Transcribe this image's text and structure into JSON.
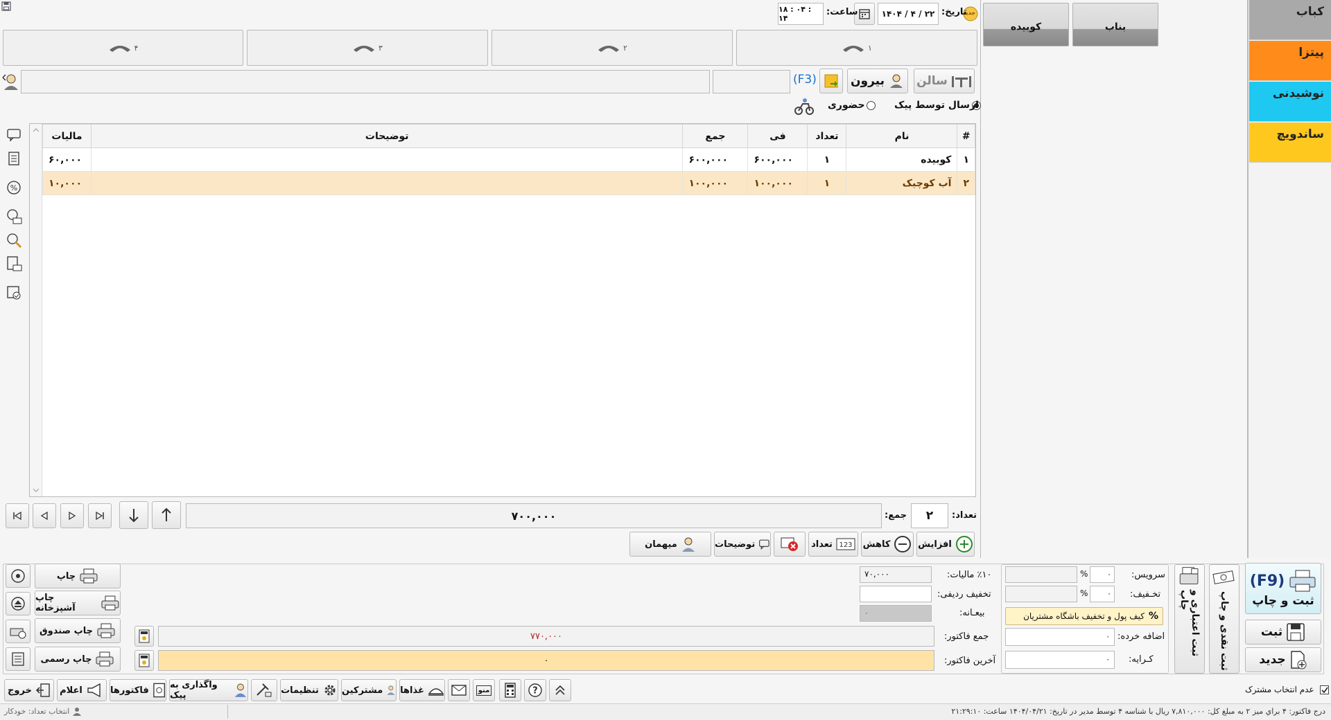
{
  "categories": [
    {
      "label": "کباب",
      "color": "#a9a9a9"
    },
    {
      "label": "پیتزا",
      "color": "#ff8c1a"
    },
    {
      "label": "نوشیدنی",
      "color": "#1ec8f0"
    },
    {
      "label": "ساندویچ",
      "color": "#ffc81e"
    }
  ],
  "products": [
    "بناب",
    "کوبیده"
  ],
  "header": {
    "new_badge": "جدید",
    "date_label": "تاریخ:",
    "date_value": "۱۴۰۴ / ۴ / ۲۲",
    "time_label": "ساعت:",
    "time_value": "۱۸ : ۰۴ : ۱۴"
  },
  "tables": [
    "۱",
    "۲",
    "۳",
    "۴"
  ],
  "order_mode": {
    "hall": "سالن",
    "out": "بیرون",
    "f3": "(F3)",
    "delivery": "ارسال توسط پیک",
    "dine_in": "حضوری"
  },
  "grid": {
    "headers": {
      "num": "#",
      "name": "نام",
      "qty": "تعداد",
      "price": "فی",
      "sum": "جمع",
      "desc": "توضیحات",
      "tax": "مالیات"
    },
    "rows": [
      {
        "num": "۱",
        "name": "کوبیده",
        "qty": "۱",
        "price": "۶۰۰,۰۰۰",
        "sum": "۶۰۰,۰۰۰",
        "desc": "",
        "tax": "۶۰,۰۰۰"
      },
      {
        "num": "۲",
        "name": "آب کوچیک",
        "qty": "۱",
        "price": "۱۰۰,۰۰۰",
        "sum": "۱۰۰,۰۰۰",
        "desc": "",
        "tax": "۱۰,۰۰۰"
      }
    ]
  },
  "totals": {
    "count_label": "تعداد:",
    "count_value": "۲",
    "sum_label": "جمع:",
    "sum_value": "۷۰۰,۰۰۰"
  },
  "row_actions": {
    "increase": "افزایش",
    "decrease": "کاهش",
    "qty": "تعداد",
    "desc": "توضیحات",
    "guest": "میهمان"
  },
  "summary": {
    "tax_label": "٪۱۰ مالیات:",
    "tax_value": "۷۰,۰۰۰",
    "row_disc_label": "تخفیف ردیفی:",
    "row_disc_value": "",
    "deposit_label": "بیعـانه:",
    "deposit_value": "۰",
    "invoice_total_label": "جمع فاکتور:",
    "invoice_total_value": "۷۷۰,۰۰۰",
    "last_invoice_label": "آخرین فاکتور:",
    "last_invoice_value": "۰"
  },
  "charges": {
    "service_label": "سرویس:",
    "service_pct": "۰",
    "discount_label": "تخـفیف:",
    "discount_pct": "۰",
    "wallet": "کیف پول و تخفیف باشگاه مشتریان",
    "extra_label": "اضافه خرده:",
    "extra_value": "۰",
    "fare_label": "کـرایه:",
    "fare_value": "۰",
    "pct_sign": "%"
  },
  "print": {
    "print": "چاپ",
    "kitchen": "چاپ آشپزخانه",
    "cashier": "چاپ صندوق",
    "official": "چاپ رسمی"
  },
  "actions": {
    "credit_print": "ثبت اعتباری و چاپ",
    "cash_print": "ثبت نقدی و چاپ",
    "f9": "(F9)",
    "save_print": "ثبت و چاپ",
    "save": "ثبت",
    "new": "جدید"
  },
  "toolbar": {
    "exit": "خروج",
    "announce": "اعلام",
    "invoices": "فاکتورها",
    "assign_courier": "واگذاری به پیک",
    "settings": "تنظیمات",
    "customers": "مشترکین",
    "foods": "غذاها",
    "menu": "منو"
  },
  "no_customer": "عدم انتخاب مشترک",
  "status": {
    "left": "انتخاب تعداد: خودکار",
    "right": "درج  فاکتور: ۴ براي ميز ۲ به مبلغ كل: ۷,۸۱۰,۰۰۰ ريال با شناسه ۴ توسط مدير در تاريخ: ۱۴۰۴/۰۴/۲۱ ساعت: ۲۱:۲۹:۱۰"
  }
}
